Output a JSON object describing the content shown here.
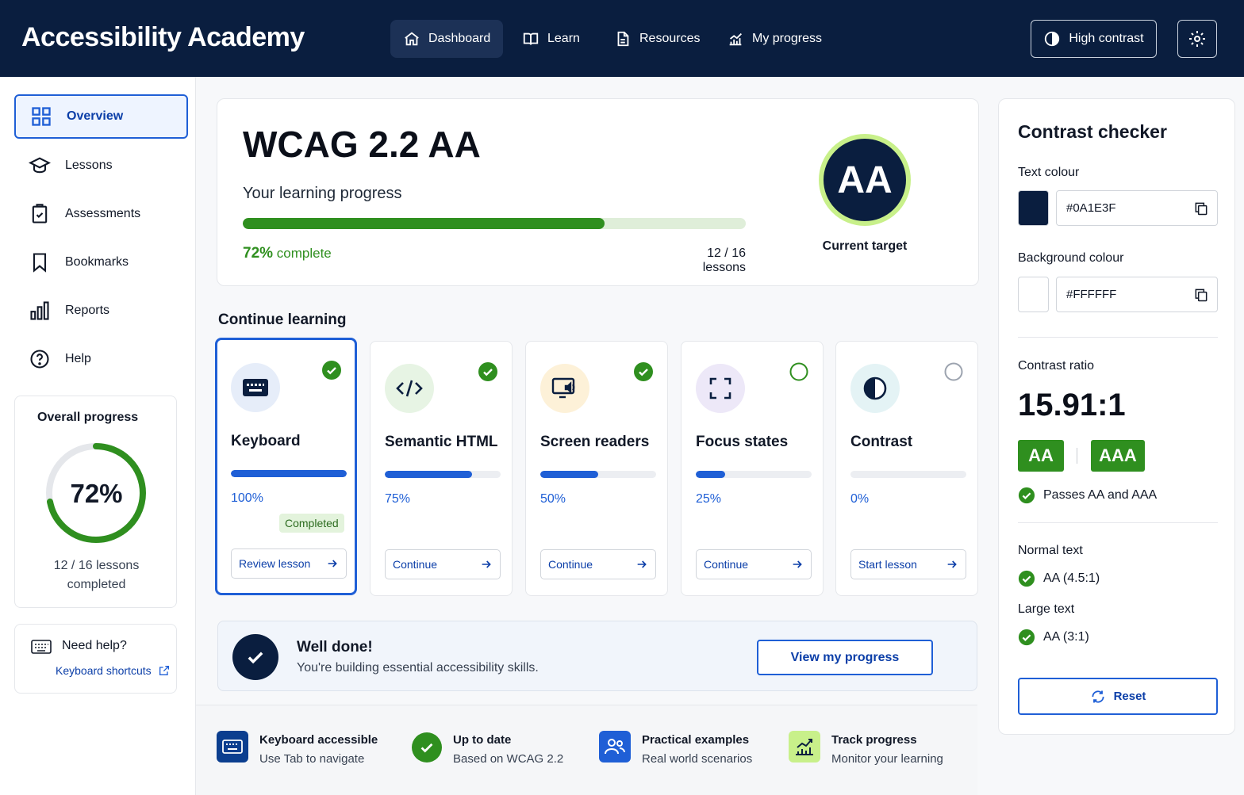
{
  "app": {
    "title": "Accessibility Academy"
  },
  "nav": {
    "items": [
      {
        "label": "Dashboard",
        "icon": "home-icon",
        "active": true
      },
      {
        "label": "Learn",
        "icon": "book-icon"
      },
      {
        "label": "Resources",
        "icon": "document-icon"
      },
      {
        "label": "My progress",
        "icon": "chart-icon"
      }
    ],
    "high_contrast": "High contrast"
  },
  "sidebar": {
    "items": [
      {
        "label": "Overview",
        "icon": "grid-icon",
        "active": true
      },
      {
        "label": "Lessons",
        "icon": "graduation-cap-icon"
      },
      {
        "label": "Assessments",
        "icon": "clipboard-check-icon"
      },
      {
        "label": "Bookmarks",
        "icon": "bookmark-icon"
      },
      {
        "label": "Reports",
        "icon": "bar-chart-icon"
      },
      {
        "label": "Help",
        "icon": "help-icon"
      }
    ],
    "overall": {
      "title": "Overall progress",
      "percent_label": "72%",
      "percent": 72,
      "lessons": "12 / 16 lessons",
      "completed": "completed"
    },
    "help": {
      "title": "Need help?",
      "link": "Keyboard shortcuts"
    }
  },
  "hero": {
    "title": "WCAG 2.2 AA",
    "subtitle": "Your learning progress",
    "progress": 72,
    "percent": "72%",
    "complete_word": "complete",
    "count": "12 / 16 lessons",
    "badge": "AA",
    "badge_caption": "Current target"
  },
  "continue": {
    "title": "Continue learning",
    "lessons": [
      {
        "name": "Keyboard",
        "percent": "100%",
        "progress": 100,
        "done": true,
        "status": "Completed",
        "button": "Review lesson",
        "icon": "keyboard-icon",
        "tint": "#e6edf9"
      },
      {
        "name": "Semantic HTML",
        "percent": "75%",
        "progress": 75,
        "done": true,
        "button": "Continue",
        "icon": "code-icon",
        "tint": "#e7f4e4"
      },
      {
        "name": "Screen readers",
        "percent": "50%",
        "progress": 50,
        "done": true,
        "button": "Continue",
        "icon": "screen-reader-icon",
        "tint": "#fdf1d8"
      },
      {
        "name": "Focus states",
        "percent": "25%",
        "progress": 25,
        "done": false,
        "button": "Continue",
        "icon": "focus-icon",
        "tint": "#ede8f8"
      },
      {
        "name": "Contrast",
        "percent": "0%",
        "progress": 0,
        "done": false,
        "button": "Start lesson",
        "icon": "contrast-icon",
        "tint": "#e4f3f5"
      }
    ]
  },
  "welldone": {
    "title": "Well done!",
    "subtitle": "You're building essential accessibility skills.",
    "button": "View my progress"
  },
  "features": [
    {
      "title": "Keyboard accessible",
      "subtitle": "Use Tab to navigate",
      "icon": "keyboard-icon"
    },
    {
      "title": "Up to date",
      "subtitle": "Based on WCAG 2.2",
      "icon": "check-circle-icon"
    },
    {
      "title": "Practical examples",
      "subtitle": "Real world scenarios",
      "icon": "users-icon"
    },
    {
      "title": "Track progress",
      "subtitle": "Monitor your learning",
      "icon": "chart-icon"
    }
  ],
  "contrast": {
    "title": "Contrast checker",
    "text_colour_label": "Text colour",
    "text_colour": "#0A1E3F",
    "bg_colour_label": "Background colour",
    "bg_colour": "#FFFFFF",
    "ratio_label": "Contrast ratio",
    "ratio": "15.91:1",
    "levels": [
      "AA",
      "AAA"
    ],
    "passes": "Passes AA and AAA",
    "normal_label": "Normal text",
    "normal_value": "AA (4.5:1)",
    "large_label": "Large text",
    "large_value": "AA (3:1)",
    "reset": "Reset"
  },
  "colors": {
    "navy": "#0a1e3f",
    "blue": "#1f5fd6",
    "green": "#2f8f1f"
  }
}
